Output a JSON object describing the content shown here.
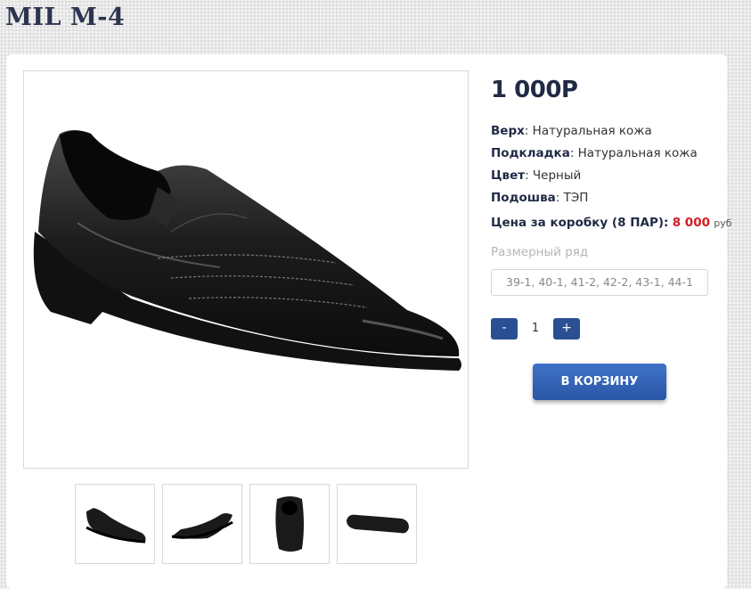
{
  "product": {
    "title": "MIL M-4",
    "price": "1 000Р",
    "specs": [
      {
        "label": "Верх",
        "value": ": Натуральная кожа"
      },
      {
        "label": "Подкладка",
        "value": ": Натуральная кожа"
      },
      {
        "label": "Цвет",
        "value": ": Черный"
      },
      {
        "label": "Подошва",
        "value": ": ТЭП"
      }
    ],
    "box_price": {
      "label": "Цена за коробку (8 ПАР):",
      "value": "8 000",
      "currency": "руб"
    },
    "size_range": {
      "label": "Размерный ряд",
      "value": "39-1, 40-1, 41-2, 42-2, 43-1, 44-1"
    }
  },
  "quantity": {
    "minus_label": "-",
    "value": "1",
    "plus_label": "+"
  },
  "cart_button": {
    "label": "В КОРЗИНУ"
  },
  "images": {
    "main": "black-leather-slip-on-shoe",
    "thumbnails": [
      "shoe-side-view",
      "shoe-angle-view",
      "shoe-front-view",
      "shoe-sole-view"
    ]
  },
  "colors": {
    "brand_dark": "#2c3450",
    "accent_blue": "#2b4f93",
    "price_red": "#d21f26"
  }
}
